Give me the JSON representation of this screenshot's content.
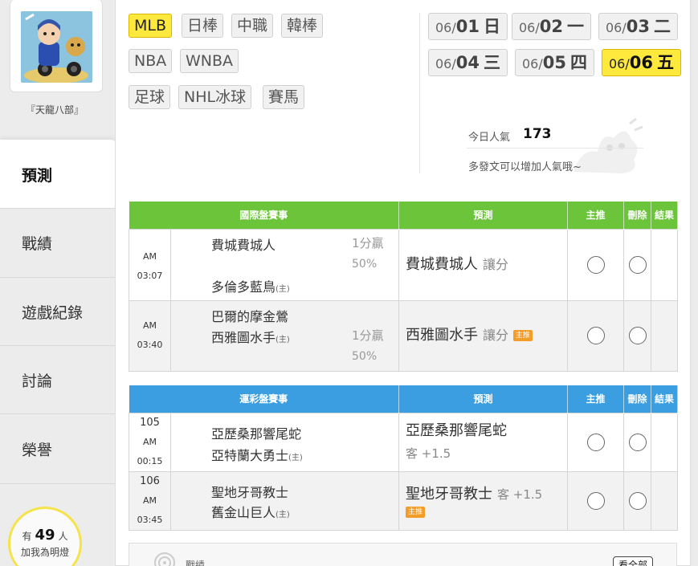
{
  "user": {
    "name": "『天龍八部』"
  },
  "nav": {
    "items": [
      {
        "label": "預測",
        "active": true
      },
      {
        "label": "戰績"
      },
      {
        "label": "遊戲紀錄"
      },
      {
        "label": "討論"
      },
      {
        "label": "榮譽"
      }
    ]
  },
  "fans": {
    "prefix": "有",
    "count": "49",
    "suffix": "人",
    "line2": "加我為明燈"
  },
  "leagues": [
    "MLB",
    "日棒",
    "中職",
    "韓棒",
    "NBA",
    "WNBA",
    "足球",
    "NHL冰球",
    "賽馬"
  ],
  "active_league": "MLB",
  "dates": [
    {
      "md": "06/",
      "day": "01",
      "wd": "日"
    },
    {
      "md": "06/",
      "day": "02",
      "wd": "一"
    },
    {
      "md": "06/",
      "day": "03",
      "wd": "二"
    },
    {
      "md": "06/",
      "day": "04",
      "wd": "三"
    },
    {
      "md": "06/",
      "day": "05",
      "wd": "四"
    },
    {
      "md": "06/",
      "day": "06",
      "wd": "五",
      "active": true
    }
  ],
  "popularity": {
    "label": "今日人氣",
    "value": "173",
    "hint": "多發文可以增加人氣哦~"
  },
  "intl_table": {
    "headers": [
      "國際盤賽事",
      "預測",
      "主推",
      "刪除",
      "結果"
    ],
    "rows": [
      {
        "time": "AM 03:07",
        "team_top": "費城費城人",
        "team_bottom": "多倫多藍鳥",
        "host_mark": "(主)",
        "odds_line1": "1分贏",
        "odds_line2": "50%",
        "pick": "費城費城人",
        "pick_sub": "讓分",
        "badge": ""
      },
      {
        "time": "AM 03:40",
        "team_top": "巴爾的摩金鶯",
        "team_bottom": "西雅圖水手",
        "host_mark": "(主)",
        "odds_line1": "1分贏",
        "odds_line2": "50%",
        "pick": "西雅圖水手",
        "pick_sub": "讓分",
        "badge": "主推"
      }
    ]
  },
  "sport_table": {
    "headers": [
      "運彩盤賽事",
      "預測",
      "主推",
      "刪除",
      "結果"
    ],
    "rows": [
      {
        "num": "105",
        "time": "AM 00:15",
        "team_top": "亞歷桑那響尾蛇",
        "team_bottom": "亞特蘭大勇士",
        "host_mark": "(主)",
        "pick": "亞歷桑那響尾蛇",
        "pick_sub": "客 +1.5",
        "badge": ""
      },
      {
        "num": "106",
        "time": "AM 03:45",
        "team_top": "聖地牙哥教士",
        "team_bottom": "舊金山巨人",
        "host_mark": "(主)",
        "pick": "聖地牙哥教士",
        "pick_sub": "客 +1.5",
        "badge": "主推"
      }
    ]
  },
  "record_card": {
    "label": "戰績",
    "button": "看全部"
  },
  "colors": {
    "intl_header": "#6cc43a",
    "sport_header": "#3a9ee0",
    "active_tab": "#ffe93d",
    "badge": "#f39c28",
    "fan_ring": "#f5e34a"
  }
}
